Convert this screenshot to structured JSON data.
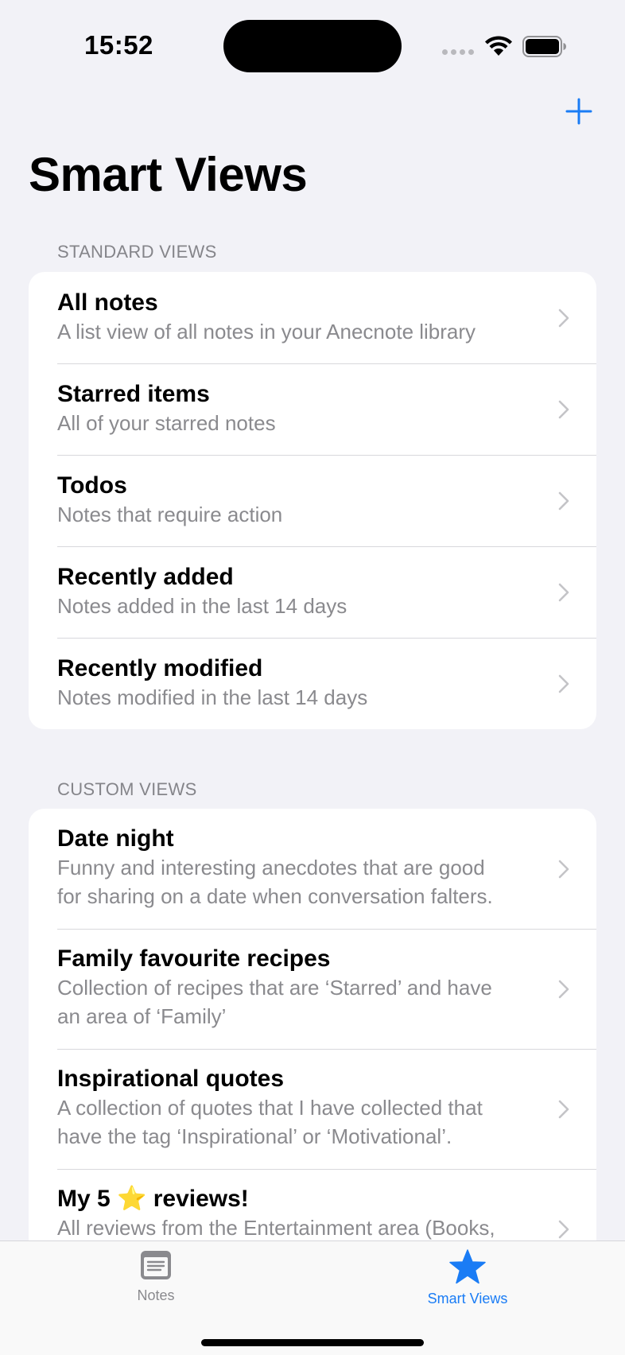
{
  "status_bar": {
    "time": "15:52"
  },
  "nav": {
    "add_icon": "plus-icon",
    "title": "Smart Views"
  },
  "standard": {
    "header": "STANDARD VIEWS",
    "items": [
      {
        "title": "All notes",
        "subtitle": "A list view of all notes in your Anecnote library"
      },
      {
        "title": "Starred items",
        "subtitle": "All of your starred notes"
      },
      {
        "title": "Todos",
        "subtitle": "Notes that require action"
      },
      {
        "title": "Recently added",
        "subtitle": "Notes added in the last 14 days"
      },
      {
        "title": "Recently modified",
        "subtitle": "Notes modified in the last 14 days"
      }
    ]
  },
  "custom": {
    "header": "CUSTOM VIEWS",
    "items": [
      {
        "title": "Date night",
        "subtitle_lines": [
          "Funny and interesting anecdotes that are good",
          "for sharing on a date when conversation falters."
        ]
      },
      {
        "title": "Family favourite recipes",
        "subtitle_lines": [
          "Collection of recipes that are ‘Starred’ and have",
          "an area of ‘Family’"
        ]
      },
      {
        "title": "Inspirational quotes",
        "subtitle_lines": [
          "A collection of quotes that I have collected that",
          "have the tag ‘Inspirational’ or ‘Motivational’."
        ]
      },
      {
        "title": "My 5 ⭐ reviews!",
        "subtitle_lines": [
          "All reviews from the Entertainment area (Books,",
          ""
        ]
      }
    ]
  },
  "tab_bar": {
    "tabs": [
      {
        "label": "Notes",
        "icon": "notes-icon",
        "selected": false
      },
      {
        "label": "Smart Views",
        "icon": "star-icon",
        "selected": true
      }
    ]
  },
  "colors": {
    "accent": "#1a7cf5",
    "background": "#f2f2f7",
    "secondary_text": "#8a8a8e"
  }
}
